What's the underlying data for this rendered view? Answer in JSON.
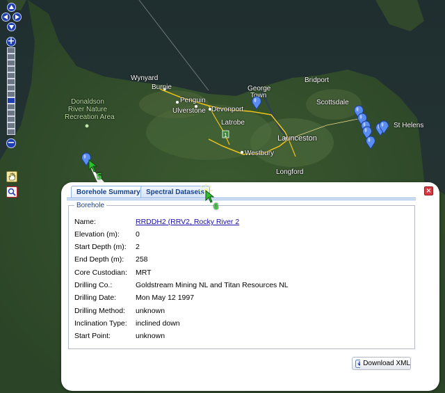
{
  "map": {
    "labels": [
      {
        "id": "wynyard",
        "text": "Wynyard"
      },
      {
        "id": "burnie",
        "text": "Burnie"
      },
      {
        "id": "penguin",
        "text": "Penguin"
      },
      {
        "id": "ulverstone",
        "text": "Ulverstone"
      },
      {
        "id": "devonport",
        "text": "Devonport"
      },
      {
        "id": "latrobe",
        "text": "Latrobe"
      },
      {
        "id": "george",
        "text": "George"
      },
      {
        "id": "town",
        "text": "Town"
      },
      {
        "id": "bridport",
        "text": "Bridport"
      },
      {
        "id": "scottsdale",
        "text": "Scottsdale"
      },
      {
        "id": "st-helens",
        "text": "St Helens"
      },
      {
        "id": "launceston",
        "text": "Launceston"
      },
      {
        "id": "westbury",
        "text": "Westbury"
      },
      {
        "id": "longford",
        "text": "Longford"
      }
    ],
    "park_label": [
      "Donaldson",
      "River Nature",
      "Recreation Area"
    ],
    "highway_shield": "1",
    "callouts": [
      "5",
      "6"
    ]
  },
  "popup": {
    "tabs": [
      {
        "label": "Borehole Summary",
        "active": true
      },
      {
        "label": "Spectral Datasets",
        "active": false
      }
    ],
    "close_symbol": "×",
    "fieldset_legend": "Borehole",
    "rows": [
      {
        "label": "Name:",
        "value": "RRDDH2 (RRV2, Rocky River 2",
        "link": true
      },
      {
        "label": "Elevation (m):",
        "value": "0"
      },
      {
        "label": "Start Depth (m):",
        "value": "2"
      },
      {
        "label": "End Depth (m):",
        "value": "258"
      },
      {
        "label": "Core Custodian:",
        "value": "MRT"
      },
      {
        "label": "Drilling Co.:",
        "value": "Goldstream Mining NL and Titan Resources NL"
      },
      {
        "label": "Drilling Date:",
        "value": "Mon May 12 1997"
      },
      {
        "label": "Drilling Method:",
        "value": "unknown"
      },
      {
        "label": "Inclination Type:",
        "value": "inclined down"
      },
      {
        "label": "Start Point:",
        "value": "unknown"
      }
    ],
    "download_label": "Download XML"
  },
  "colors": {
    "accent": "#15428b",
    "marker": "#5b8cf0",
    "road": "#f0c419",
    "control": "#1f3fb0"
  }
}
